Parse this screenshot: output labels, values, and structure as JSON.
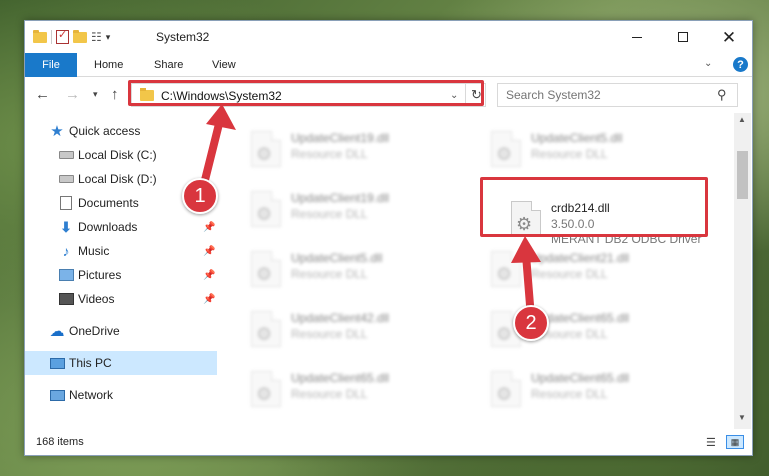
{
  "window": {
    "title": "System32",
    "controls": {
      "minimize_icon": "minimize-icon",
      "maximize_icon": "maximize-icon",
      "close_icon": "close-icon"
    }
  },
  "ribbon": {
    "tabs": [
      "File",
      "Home",
      "Share",
      "View"
    ],
    "help_label": "?"
  },
  "navbar": {
    "address": "C:\\Windows\\System32",
    "search_placeholder": "Search System32"
  },
  "sidebar": {
    "items": [
      {
        "label": "Quick access",
        "icon": "star-icon"
      },
      {
        "label": "Local Disk (C:)",
        "icon": "drive-icon"
      },
      {
        "label": "Local Disk (D:)",
        "icon": "drive-icon"
      },
      {
        "label": "Documents",
        "icon": "document-icon"
      },
      {
        "label": "Downloads",
        "icon": "download-icon"
      },
      {
        "label": "Music",
        "icon": "music-icon"
      },
      {
        "label": "Pictures",
        "icon": "pictures-icon"
      },
      {
        "label": "Videos",
        "icon": "videos-icon"
      },
      {
        "label": "OneDrive",
        "icon": "cloud-icon"
      },
      {
        "label": "This PC",
        "icon": "pc-icon"
      },
      {
        "label": "Network",
        "icon": "network-icon"
      }
    ]
  },
  "files": {
    "left": [
      {
        "name": "UpdateClient19.dll",
        "type": "Resource DLL"
      },
      {
        "name": "UpdateClient19.dll",
        "type": "Resource DLL"
      },
      {
        "name": "UpdateClient5.dll",
        "type": "Resource DLL"
      },
      {
        "name": "UpdateClient42.dll",
        "type": "Resource DLL"
      },
      {
        "name": "UpdateClient65.dll",
        "type": "Resource DLL"
      }
    ],
    "right": [
      {
        "name": "UpdateClient5.dll",
        "type": "Resource DLL"
      },
      {
        "name": "crdb214.dll",
        "version": "3.50.0.0",
        "description": "MERANT DB2 ODBC Driver"
      },
      {
        "name": "UpdateClient21.dll",
        "type": "Resource DLL"
      },
      {
        "name": "UpdateClient65.dll",
        "type": "Resource DLL"
      },
      {
        "name": "UpdateClient65.dll",
        "type": "Resource DLL"
      }
    ]
  },
  "status": {
    "item_count": "168 items"
  },
  "annotations": {
    "step1": "1",
    "step2": "2",
    "accent": "#d9363e"
  }
}
